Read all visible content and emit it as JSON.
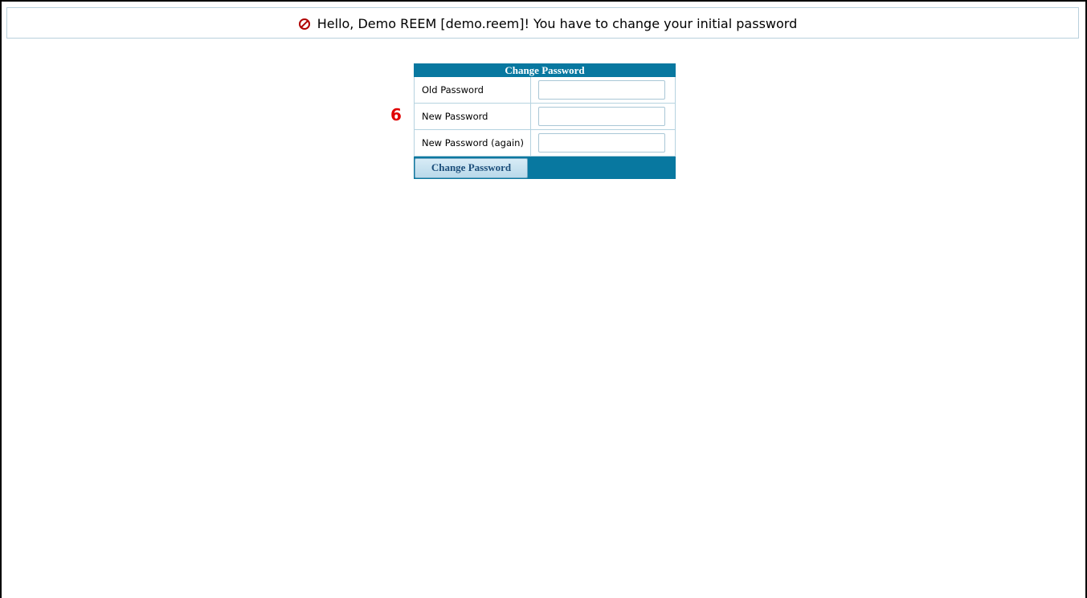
{
  "banner": {
    "icon": "forbidden-icon",
    "message": "Hello, Demo REEM [demo.reem]! You have to change your initial password",
    "icon_color": "#b00000"
  },
  "step_marker": "6",
  "form": {
    "title": "Change Password",
    "fields": [
      {
        "label": "Old Password",
        "value": ""
      },
      {
        "label": "New Password",
        "value": ""
      },
      {
        "label": "New Password (again)",
        "value": ""
      }
    ],
    "submit_label": "Change Password"
  },
  "colors": {
    "panel_header": "#0878a0",
    "marker": "#e00000"
  }
}
